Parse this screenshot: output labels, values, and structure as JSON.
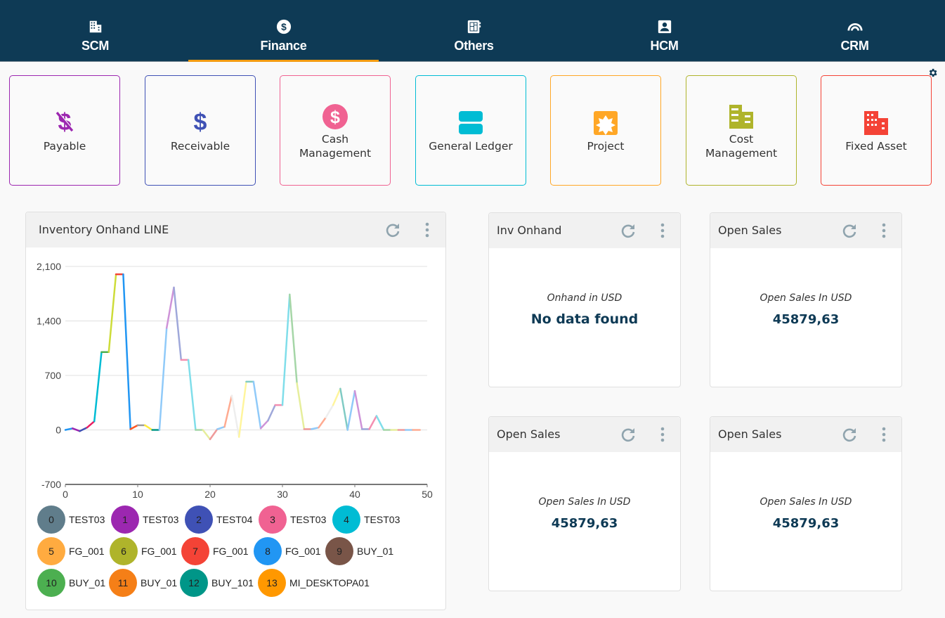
{
  "nav": {
    "items": [
      {
        "label": "SCM",
        "icon": "building-icon",
        "active": false
      },
      {
        "label": "Finance",
        "icon": "dollar-circle-icon",
        "active": true
      },
      {
        "label": "Others",
        "icon": "grid-notebook-icon",
        "active": false
      },
      {
        "label": "HCM",
        "icon": "person-card-icon",
        "active": false
      },
      {
        "label": "CRM",
        "icon": "arc-signal-icon",
        "active": false
      }
    ],
    "active_color": "#f39c12",
    "background": "#0e3a55"
  },
  "settings_icon": "gear-icon",
  "tiles": [
    {
      "label": "Payable",
      "icon": "money-off-icon",
      "color": "#9c27b0"
    },
    {
      "label": "Receivable",
      "icon": "dollar-icon",
      "color": "#3f51b5"
    },
    {
      "label": "Cash Management",
      "label_lines": [
        "Cash",
        "Management"
      ],
      "icon": "dollar-circle-icon",
      "color": "#f06292"
    },
    {
      "label": "General Ledger",
      "icon": "ledger-storage-icon",
      "color": "#00bcd4"
    },
    {
      "label": "Project",
      "icon": "project-puzzle-icon",
      "color": "#ffa726"
    },
    {
      "label": "Cost Management",
      "label_lines": [
        "Cost",
        "Management"
      ],
      "icon": "buildings-icon",
      "color": "#afb42b"
    },
    {
      "label": "Fixed Asset",
      "icon": "building-icon",
      "color": "#f44336"
    }
  ],
  "panels": {
    "chart": {
      "title": "Inventory Onhand LINE",
      "refresh_icon": "refresh-icon",
      "menu_icon": "more-vertical-icon"
    },
    "inv_onhand": {
      "title": "Inv Onhand",
      "label": "Onhand in USD",
      "value": "No data found"
    },
    "open_sales_1": {
      "title": "Open Sales",
      "label": "Open Sales In USD",
      "value": "45879,63"
    },
    "open_sales_2": {
      "title": "Open Sales",
      "label": "Open Sales In USD",
      "value": "45879,63"
    },
    "open_sales_3": {
      "title": "Open Sales",
      "label": "Open Sales In USD",
      "value": "45879,63"
    }
  },
  "chart_data": {
    "type": "line",
    "title": "Inventory Onhand LINE",
    "xlabel": "",
    "ylabel": "",
    "xlim": [
      0,
      50
    ],
    "ylim": [
      -700,
      2100
    ],
    "xticks": [
      "0",
      "10",
      "20",
      "30",
      "40",
      "50"
    ],
    "yticks": [
      "2,100",
      "1,400",
      "700",
      "0",
      "-700"
    ],
    "ytick_values": [
      2100,
      1400,
      700,
      0,
      -700
    ],
    "xtick_values": [
      0,
      10,
      20,
      30,
      40,
      50
    ],
    "grid": true,
    "x": [
      0,
      1,
      2,
      3,
      4,
      5,
      6,
      7,
      8,
      9,
      10,
      11,
      12,
      13,
      14,
      15,
      16,
      17,
      18,
      19,
      20,
      21,
      22,
      23,
      24,
      25,
      26,
      27,
      28,
      29,
      30,
      31,
      32,
      33,
      34,
      35,
      36,
      37,
      38,
      39,
      40,
      41,
      42,
      43,
      44,
      45,
      46,
      47,
      48,
      49
    ],
    "values": [
      0,
      20,
      -15,
      30,
      110,
      1000,
      1000,
      2000,
      2000,
      10,
      60,
      60,
      0,
      0,
      1310,
      1830,
      900,
      900,
      0,
      0,
      -120,
      10,
      40,
      440,
      -90,
      620,
      620,
      20,
      120,
      320,
      320,
      1740,
      600,
      10,
      10,
      30,
      160,
      320,
      530,
      0,
      500,
      10,
      10,
      180,
      0,
      0,
      0,
      0,
      0,
      0
    ],
    "segment_colors": [
      "#2196f3",
      "#9c27b0",
      "#3f51b5",
      "#e91e63",
      "#00bcd4",
      "#4caf50",
      "#cddc39",
      "#f44336",
      "#2196f3",
      "#ff5722",
      "#9e9e9e",
      "#ffeb3b",
      "#009688",
      "#90caf9",
      "#ce93d8",
      "#9fa8da",
      "#f48fb1",
      "#80deea",
      "#a5d6a7",
      "#e6ee9c",
      "#ef9a9a",
      "#90caf9",
      "#ffab91",
      "#eeeeee",
      "#fff59d",
      "#80cbc4",
      "#90caf9",
      "#ce93d8",
      "#9fa8da",
      "#f48fb1",
      "#80deea",
      "#a5d6a7",
      "#e6ee9c",
      "#ef9a9a",
      "#90caf9",
      "#ffab91",
      "#eeeeee",
      "#fff59d",
      "#80cbc4",
      "#90caf9",
      "#ce93d8",
      "#9fa8da",
      "#f48fb1",
      "#80deea",
      "#a5d6a7",
      "#e6ee9c",
      "#ef9a9a",
      "#90caf9",
      "#ffab91"
    ],
    "legend": [
      {
        "index": "0",
        "label": "TEST03",
        "color": "#607d8b"
      },
      {
        "index": "1",
        "label": "TEST03",
        "color": "#9c27b0"
      },
      {
        "index": "2",
        "label": "TEST04",
        "color": "#3f51b5"
      },
      {
        "index": "3",
        "label": "TEST03",
        "color": "#f06292"
      },
      {
        "index": "4",
        "label": "TEST03",
        "color": "#00bcd4"
      },
      {
        "index": "5",
        "label": "FG_001",
        "color": "#ffab40"
      },
      {
        "index": "6",
        "label": "FG_001",
        "color": "#afb42b"
      },
      {
        "index": "7",
        "label": "FG_001",
        "color": "#f44336"
      },
      {
        "index": "8",
        "label": "FG_001",
        "color": "#2196f3"
      },
      {
        "index": "9",
        "label": "BUY_01",
        "color": "#795548"
      },
      {
        "index": "10",
        "label": "BUY_01",
        "color": "#4caf50"
      },
      {
        "index": "11",
        "label": "BUY_01",
        "color": "#f57f17"
      },
      {
        "index": "12",
        "label": "BUY_101",
        "color": "#009688"
      },
      {
        "index": "13",
        "label": "MI_DESKTOPA01",
        "color": "#ff9800"
      }
    ],
    "legend_position": "bottom"
  }
}
